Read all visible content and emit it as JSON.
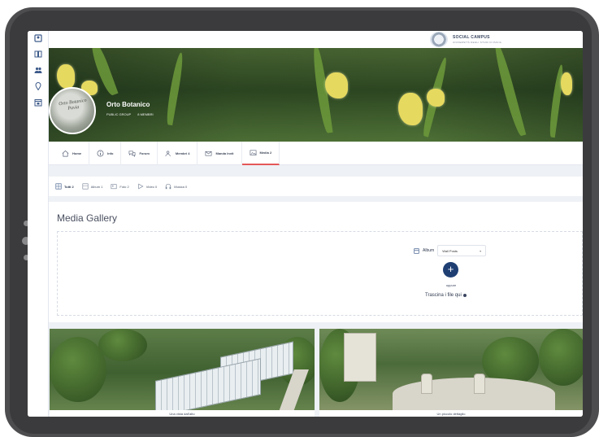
{
  "brand": {
    "name": "SOCIAL CAMPUS",
    "tagline": "UNIVERSITÀ DEGLI STUDI DI PAVIA"
  },
  "sidebar": {
    "items": [
      {
        "icon": "profile-card-icon"
      },
      {
        "icon": "book-icon"
      },
      {
        "icon": "users-icon"
      },
      {
        "icon": "location-pin-icon"
      },
      {
        "icon": "calendar-icon"
      }
    ]
  },
  "group": {
    "name": "Orto Botanico",
    "type": "PUBLIC GROUP",
    "members": "8 MEMBRI",
    "avatar_text": "Orto Botanico Pavia"
  },
  "tabs": [
    {
      "label": "Home",
      "icon": "home-icon"
    },
    {
      "label": "Info",
      "icon": "info-icon"
    },
    {
      "label": "Forum",
      "icon": "forum-icon"
    },
    {
      "label": "Membri 4",
      "icon": "members-icon"
    },
    {
      "label": "Manda Invit",
      "icon": "mail-icon"
    },
    {
      "label": "Media 2",
      "icon": "media-icon",
      "active": true
    }
  ],
  "filters": [
    {
      "label": "Tutti 2",
      "icon": "grid-icon",
      "active": true
    },
    {
      "label": "Album 1",
      "icon": "album-icon"
    },
    {
      "label": "Foto 2",
      "icon": "photo-icon"
    },
    {
      "label": "Video 0",
      "icon": "video-icon"
    },
    {
      "label": "Musica 0",
      "icon": "headphones-icon"
    }
  ],
  "gallery": {
    "title": "Media Gallery",
    "album_label": "Album",
    "album_value": "Wall Posts",
    "oppure": "oppure",
    "drag_text": "Trascina i file qui"
  },
  "photos": [
    {
      "caption": "Una vista dall'alto"
    },
    {
      "caption": "Un piccolo dettaglio"
    }
  ],
  "colors": {
    "accent_tab": "#e55858",
    "primary_button": "#1f3f73",
    "device_frame": "#4d4d4f"
  }
}
